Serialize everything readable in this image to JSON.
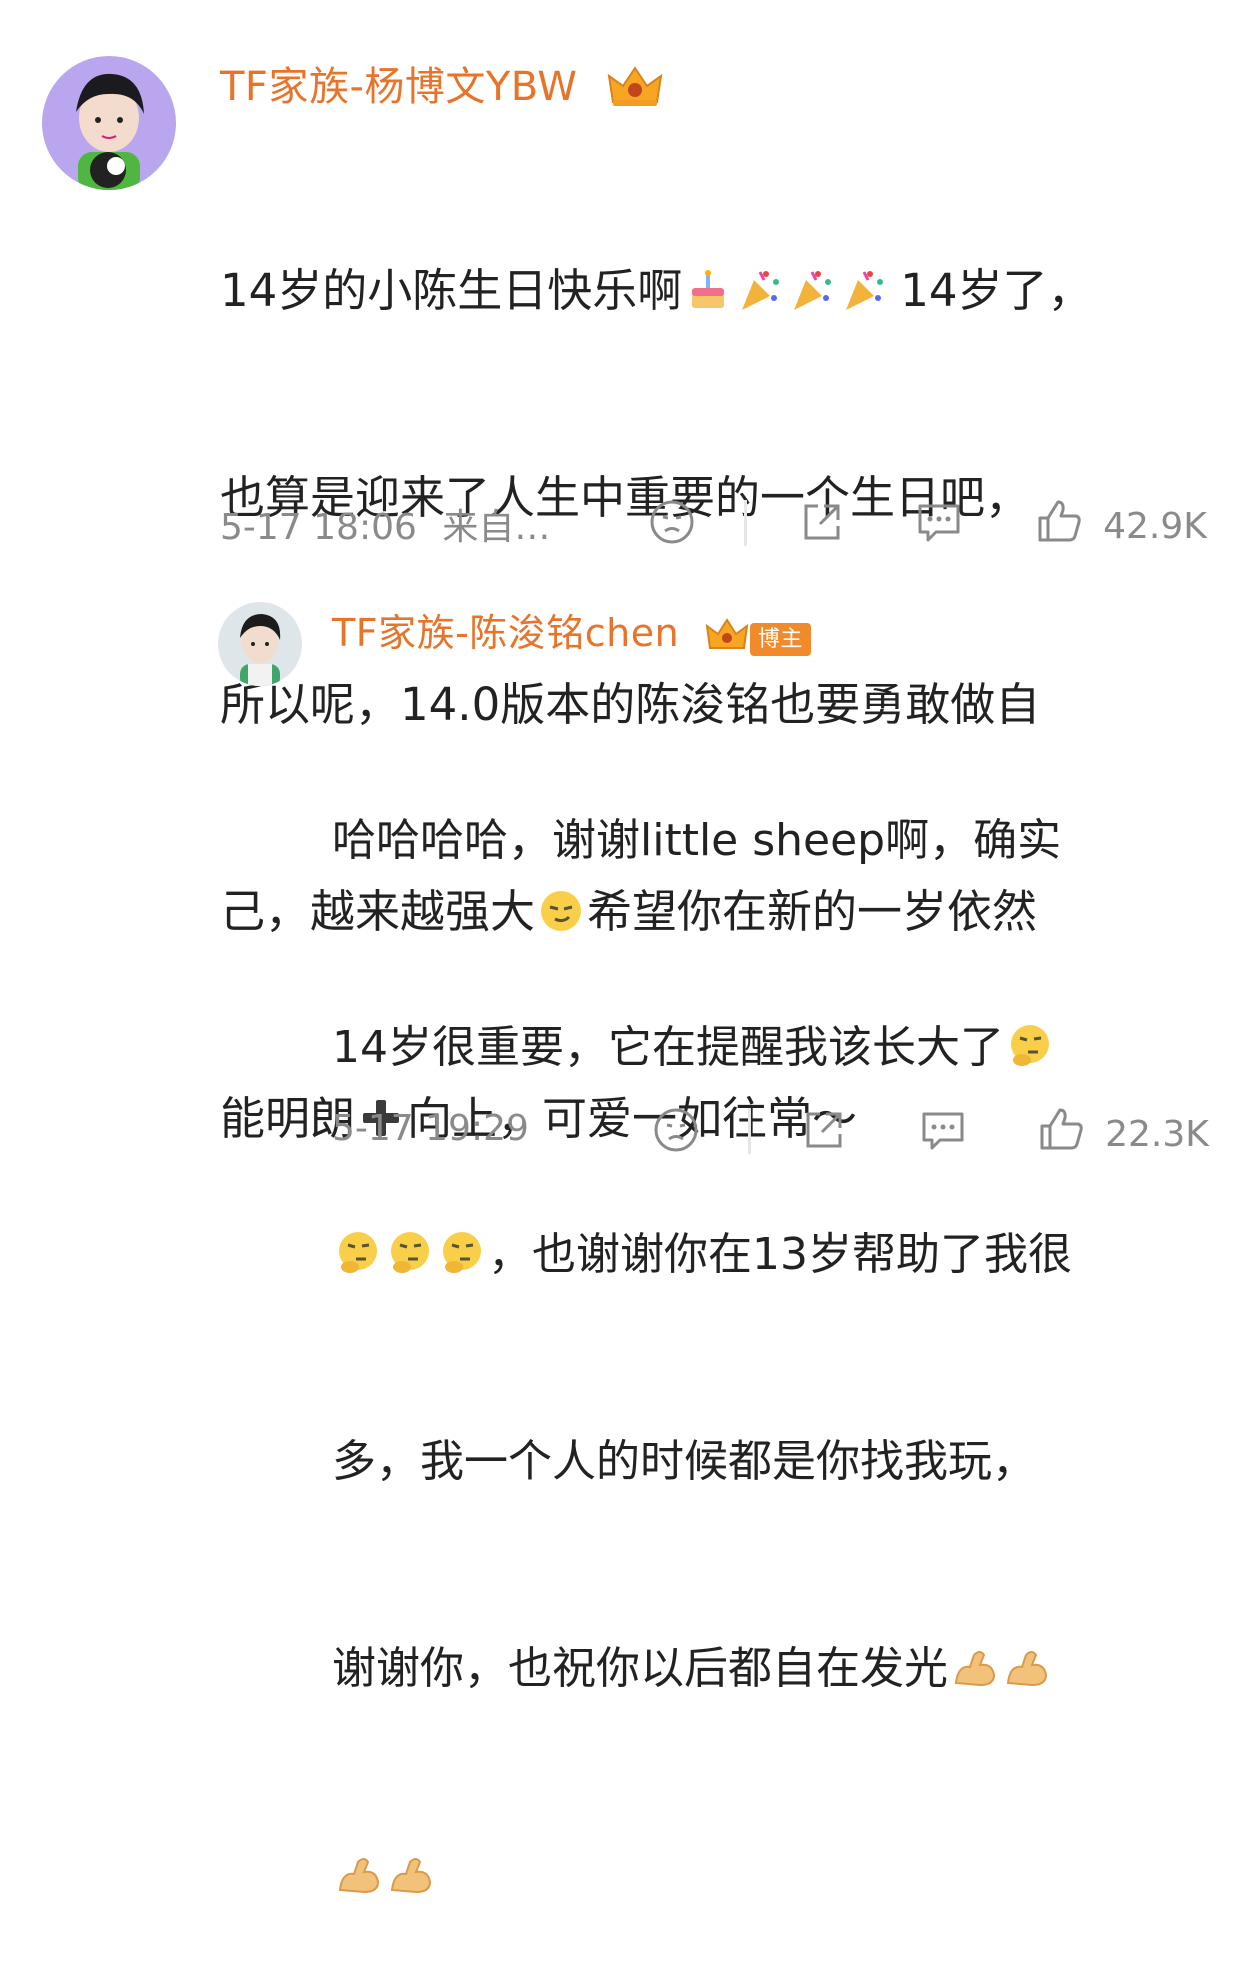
{
  "comment": {
    "username": "TF家族-杨博文YBW",
    "text_l1a": "14岁的小陈生日快乐啊",
    "text_l1b": "14岁了，",
    "text_l2": "也算是迎来了人生中重要的一个生日吧，",
    "text_l3": "所以呢，14.0版本的陈浚铭也要勇敢做自",
    "text_l4a": "己，越来越强大",
    "text_l4b": "希望你在新的一岁依然",
    "text_l5a": "能明朗",
    "text_l5b": "向上，可爱一如往常～",
    "timestamp": "5-17 18:06",
    "source": "来自…",
    "likes": "42.9K"
  },
  "reply": {
    "username": "TF家族-陈浚铭chen",
    "badge": "博主",
    "text_l1": "哈哈哈哈，谢谢little sheep啊，确实",
    "text_l2": "14岁很重要，它在提醒我该长大了",
    "text_l3": "，也谢谢你在13岁帮助了我很",
    "text_l4": "多，我一个人的时候都是你找我玩，",
    "text_l5": "谢谢你，也祝你以后都自在发光",
    "timestamp": "5-17 19:29",
    "likes": "22.3K"
  },
  "colors": {
    "username": "#e8742a",
    "meta": "#8a8a8a",
    "text": "#222222"
  },
  "icons": [
    "crown-icon",
    "birthday-cake-emoji",
    "party-popper-emoji",
    "smug-emoji",
    "plus-emoji",
    "thinking-emoji",
    "flex-arm-emoji",
    "sad-face-icon",
    "share-icon",
    "comment-icon",
    "like-icon"
  ]
}
